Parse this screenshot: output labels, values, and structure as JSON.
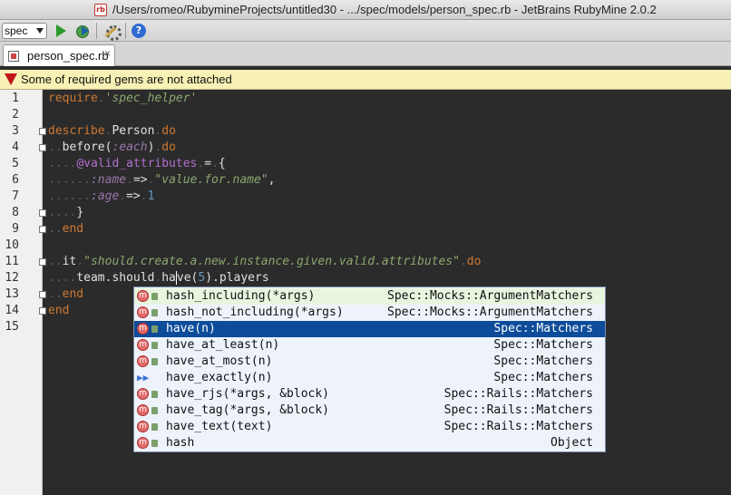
{
  "window": {
    "title": "/Users/romeo/RubymineProjects/untitled30 - .../spec/models/person_spec.rb - JetBrains RubyMine 2.0.2"
  },
  "toolbar": {
    "run_config": "spec"
  },
  "tabs": [
    {
      "label": "person_spec.rb"
    }
  ],
  "warning": {
    "text": "Some of required gems are not attached"
  },
  "editor": {
    "line_numbers": [
      "1",
      "2",
      "3",
      "4",
      "5",
      "6",
      "7",
      "8",
      "9",
      "10",
      "11",
      "12",
      "13",
      "14",
      "15"
    ],
    "lines": [
      {
        "n": 1,
        "html": "<span class='req'>require</span><span class='dot'>.</span><span class='str'>'spec_helper'</span>"
      },
      {
        "n": 2,
        "html": ""
      },
      {
        "n": 3,
        "html": "<span class='kw'>describe</span><span class='dot'>.</span><span class='cls'>Person</span><span class='dot'>.</span><span class='kw'>do</span>"
      },
      {
        "n": 4,
        "html": "<span class='dot'>..</span><span class='cls'>before</span>(<span class='sym'>:each</span>)<span class='dot'>.</span><span class='kw'>do</span>"
      },
      {
        "n": 5,
        "html": "<span class='dot'>....</span><span class='ivar'>@valid_attributes</span><span class='dot'>.</span>=<span class='dot'>.</span>{"
      },
      {
        "n": 6,
        "html": "<span class='dot'>......</span><span class='sym'>:name</span><span class='dot'>.</span>=&gt;<span class='dot'>.</span><span class='str'>\"value.for.name\"</span>,"
      },
      {
        "n": 7,
        "html": "<span class='dot'>......</span><span class='sym'>:age</span><span class='dot'>.</span>=&gt;<span class='dot'>.</span><span class='num'>1</span>"
      },
      {
        "n": 8,
        "html": "<span class='dot'>....</span>}"
      },
      {
        "n": 9,
        "html": "<span class='dot'>..</span><span class='kw'>end</span>"
      },
      {
        "n": 10,
        "html": ""
      },
      {
        "n": 11,
        "html": "<span class='dot'>..</span>it<span class='dot'>.</span><span class='str'>\"should.create.a.new.instance.given.valid.attributes\"</span><span class='dot'>.</span><span class='kw'>do</span>"
      },
      {
        "n": 12,
        "html": "<span class='dot'>....</span>team.should<span class='dot'>.</span>ha<span class='caret-mark'></span>ve(<span class='num'>5</span>).players"
      },
      {
        "n": 13,
        "html": "<span class='dot'>..</span><span class='kw'>end</span>"
      },
      {
        "n": 14,
        "html": "<span class='kw'>end</span>"
      },
      {
        "n": 15,
        "html": ""
      }
    ]
  },
  "completion": {
    "items": [
      {
        "kind": "method",
        "name": "hash_including(*args)",
        "type": "Spec::Mocks::ArgumentMatchers",
        "state": "first"
      },
      {
        "kind": "method",
        "name": "hash_not_including(*args)",
        "type": "Spec::Mocks::ArgumentMatchers",
        "state": ""
      },
      {
        "kind": "method",
        "name": "have(n)",
        "type": "Spec::Matchers",
        "state": "selected"
      },
      {
        "kind": "method",
        "name": "have_at_least(n)",
        "type": "Spec::Matchers",
        "state": ""
      },
      {
        "kind": "method",
        "name": "have_at_most(n)",
        "type": "Spec::Matchers",
        "state": ""
      },
      {
        "kind": "alias",
        "name": "have_exactly(n)",
        "type": "Spec::Matchers",
        "state": ""
      },
      {
        "kind": "method",
        "name": "have_rjs(*args, &block)",
        "type": "Spec::Rails::Matchers",
        "state": ""
      },
      {
        "kind": "method",
        "name": "have_tag(*args, &block)",
        "type": "Spec::Rails::Matchers",
        "state": ""
      },
      {
        "kind": "method",
        "name": "have_text(text)",
        "type": "Spec::Rails::Matchers",
        "state": ""
      },
      {
        "kind": "method",
        "name": "hash",
        "type": "Object",
        "state": ""
      }
    ]
  }
}
